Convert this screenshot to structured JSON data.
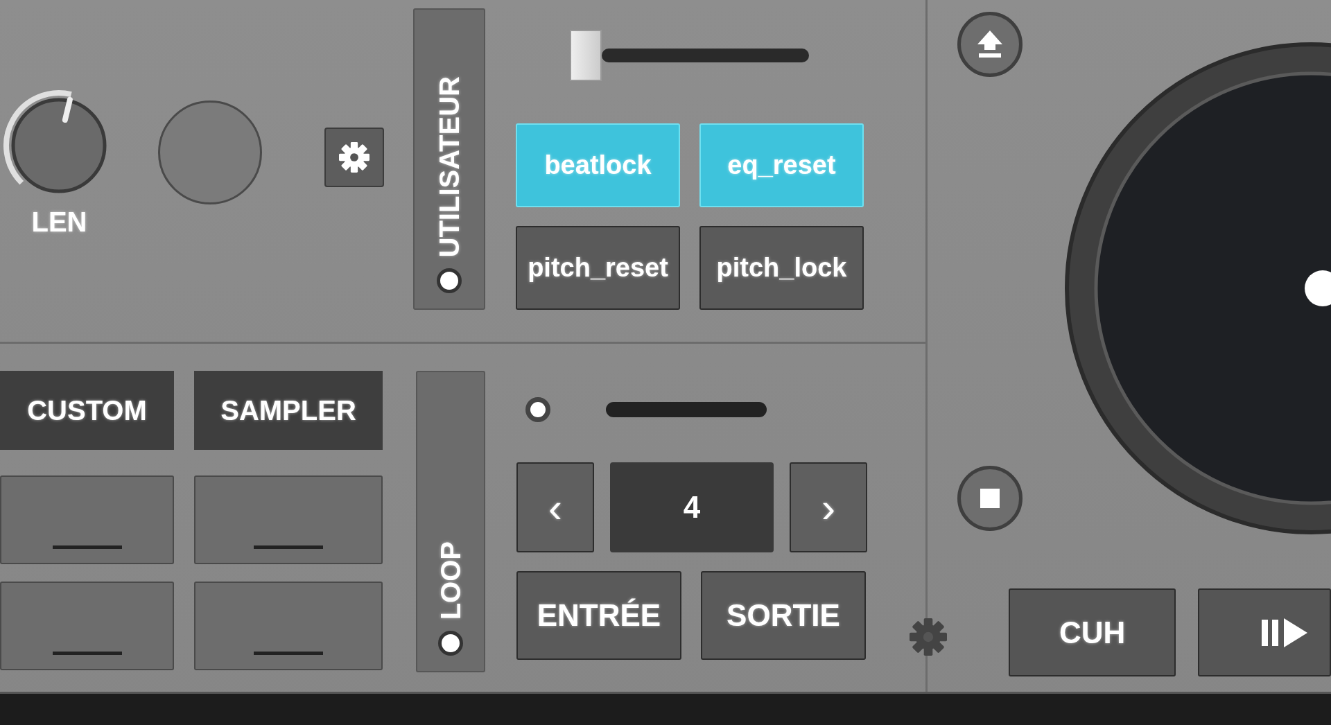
{
  "knobs": [
    {
      "label": "LEN"
    }
  ],
  "user_panel": {
    "label": "UTILISATEUR"
  },
  "pitch_slider": {
    "level": 0
  },
  "deck_buttons": [
    {
      "label": "beatlock",
      "on": true
    },
    {
      "label": "eq_reset",
      "on": true
    },
    {
      "label": "pitch_reset",
      "on": false
    },
    {
      "label": "pitch_lock",
      "on": false
    }
  ],
  "pad_tabs": [
    {
      "label": "CUSTOM"
    },
    {
      "label": "SAMPLER"
    }
  ],
  "loop": {
    "label": "LOOP",
    "prev": "‹",
    "size": "4",
    "next": "›",
    "buttons": [
      "ENTRÉE",
      "SORTIE"
    ]
  },
  "transport": {
    "cue": "CUH"
  }
}
